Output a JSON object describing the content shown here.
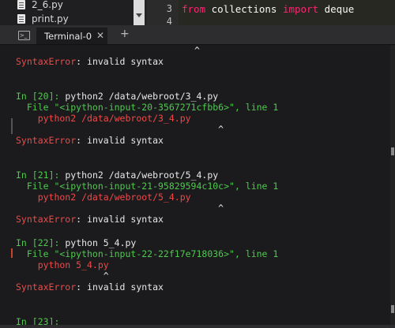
{
  "file_tree": {
    "items": [
      {
        "name": "2_6.py"
      },
      {
        "name": "print.py"
      }
    ]
  },
  "editor": {
    "line_number": "3",
    "next_line_number": "4",
    "code_keyword_1": "from",
    "code_module": " collections ",
    "code_keyword_2": "import",
    "code_name": " deque"
  },
  "terminal_tabs": {
    "tab_label": "Terminal-0",
    "close_glyph": "✕",
    "add_glyph": "+"
  },
  "terminal": {
    "caret_top": "^",
    "block0_error_type": "SyntaxError",
    "block0_error_msg": ": invalid syntax",
    "block1": {
      "prompt_in": "In [",
      "prompt_num": "20",
      "prompt_close": "]: ",
      "command": "python2 /data/webroot/3_4.py",
      "file_line": "  File \"<ipython-input-20-3567271cfbb6>\", line 1",
      "source_line": "    python2 /data/webroot/3_4.py",
      "caret": "                                     ^",
      "error_type": "SyntaxError",
      "error_msg": ": invalid syntax"
    },
    "block2": {
      "prompt_in": "In [",
      "prompt_num": "21",
      "prompt_close": "]: ",
      "command": "python2 /data/webroot/5_4.py",
      "file_line": "  File \"<ipython-input-21-95829594c10c>\", line 1",
      "source_line": "    python2 /data/webroot/5_4.py",
      "caret": "                                     ^",
      "error_type": "SyntaxError",
      "error_msg": ": invalid syntax"
    },
    "block3": {
      "prompt_in": "In [",
      "prompt_num": "22",
      "prompt_close": "]: ",
      "command": "python 5_4.py",
      "file_line": "  File \"<ipython-input-22-22f17e718036>\", line 1",
      "source_line": "    python 5_4.py",
      "caret": "                ^",
      "error_type": "SyntaxError",
      "error_msg": ": invalid syntax"
    },
    "block4": {
      "prompt_in": "In [",
      "prompt_num": "23",
      "prompt_close": "]:"
    }
  },
  "colors": {
    "error": "#f44747",
    "prompt": "#4ec94e",
    "keyword": "#f92672"
  }
}
